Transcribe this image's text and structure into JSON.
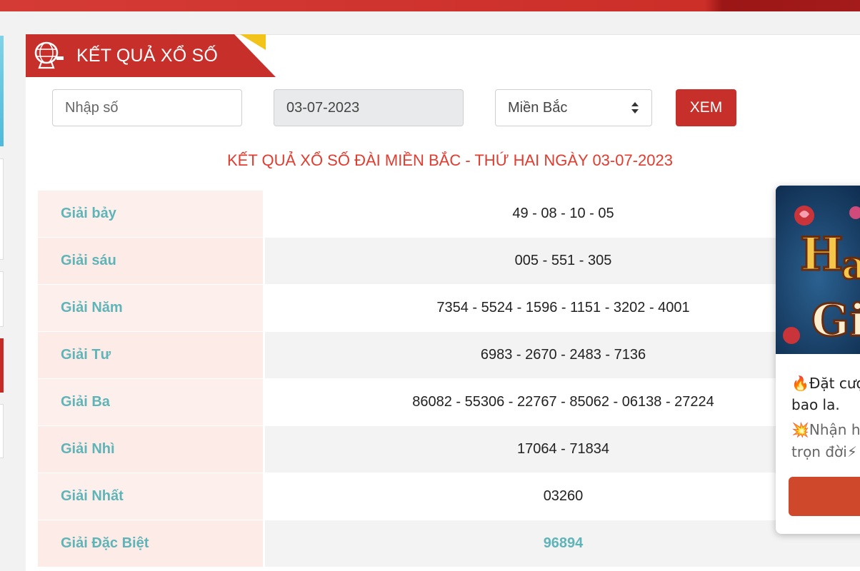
{
  "header": {
    "title": "KẾT QUẢ XỔ SỐ"
  },
  "search": {
    "number_placeholder": "Nhập số",
    "date_value": "03-07-2023",
    "region_selected": "Miền Bắc",
    "submit_label": "XEM"
  },
  "results": {
    "heading": "KẾT QUẢ XỔ SỐ ĐÀI MIỀN BẮC - THỨ HAI NGÀY 03-07-2023",
    "rows": [
      {
        "label": "Giải bảy",
        "value": "49 - 08 - 10 - 05"
      },
      {
        "label": "Giải sáu",
        "value": "005 - 551 - 305"
      },
      {
        "label": "Giải Năm",
        "value": "7354 - 5524 - 1596 - 1151 - 3202 - 4001"
      },
      {
        "label": "Giải Tư",
        "value": "6983 - 2670 - 2483 - 7136"
      },
      {
        "label": "Giải Ba",
        "value": "86082 - 55306 - 22767 - 85062 - 06138 - 27224"
      },
      {
        "label": "Giải Nhì",
        "value": "17064 - 71834"
      },
      {
        "label": "Giải Nhất",
        "value": "03260"
      },
      {
        "label": "Giải Đặc Biệt",
        "value": "96894"
      }
    ]
  },
  "popup": {
    "line1": "🔥Đặt cượ",
    "line2": "bao la.",
    "line3": "💥Nhận h",
    "line4": "trọn đời⚡"
  },
  "colors": {
    "brand_red": "#c62f2a",
    "heading_red": "#e03c2f",
    "label_teal": "#5fb4b8"
  },
  "icons": {
    "logo": "lottery-ball-logo-icon",
    "region_select": "sort-arrows-icon"
  }
}
